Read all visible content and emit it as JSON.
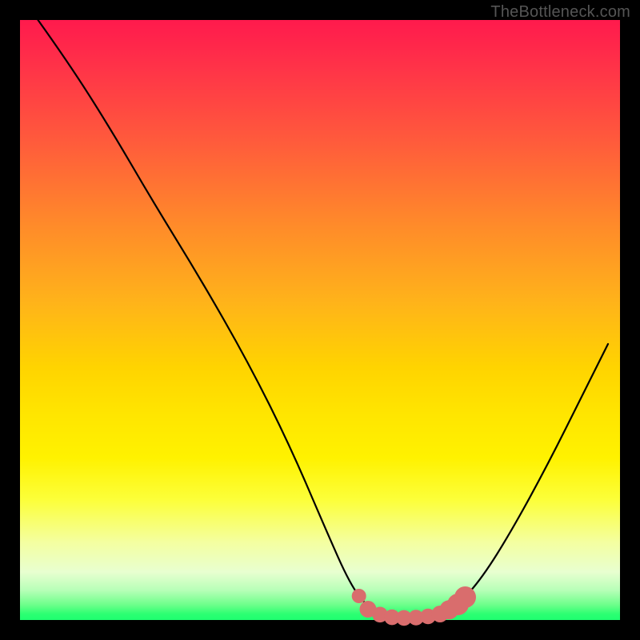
{
  "watermark": "TheBottleneck.com",
  "colors": {
    "page_bg": "#000000",
    "gradient_top": "#ff1a4d",
    "gradient_mid": "#ffe600",
    "gradient_bottom": "#1fff70",
    "curve_stroke": "#000000",
    "marker_fill": "#d96d6d",
    "watermark_text": "#555555"
  },
  "chart_data": {
    "type": "line",
    "title": "",
    "xlabel": "",
    "ylabel": "",
    "xlim": [
      0,
      100
    ],
    "ylim": [
      0,
      100
    ],
    "curve": [
      {
        "x": 3,
        "y": 100
      },
      {
        "x": 8,
        "y": 93
      },
      {
        "x": 15,
        "y": 82
      },
      {
        "x": 22,
        "y": 70
      },
      {
        "x": 30,
        "y": 57
      },
      {
        "x": 38,
        "y": 43
      },
      {
        "x": 45,
        "y": 29
      },
      {
        "x": 51,
        "y": 15
      },
      {
        "x": 55,
        "y": 6
      },
      {
        "x": 58,
        "y": 2
      },
      {
        "x": 62,
        "y": 0.5
      },
      {
        "x": 66,
        "y": 0.4
      },
      {
        "x": 70,
        "y": 1
      },
      {
        "x": 73,
        "y": 2.5
      },
      {
        "x": 77,
        "y": 7
      },
      {
        "x": 82,
        "y": 15
      },
      {
        "x": 88,
        "y": 26
      },
      {
        "x": 94,
        "y": 38
      },
      {
        "x": 98,
        "y": 46
      }
    ],
    "markers": [
      {
        "x": 56.5,
        "y": 4.0,
        "r": 1.2
      },
      {
        "x": 58.0,
        "y": 1.8,
        "r": 1.4
      },
      {
        "x": 60.0,
        "y": 0.9,
        "r": 1.3
      },
      {
        "x": 62.0,
        "y": 0.45,
        "r": 1.3
      },
      {
        "x": 64.0,
        "y": 0.35,
        "r": 1.3
      },
      {
        "x": 66.0,
        "y": 0.4,
        "r": 1.3
      },
      {
        "x": 68.0,
        "y": 0.6,
        "r": 1.3
      },
      {
        "x": 70.0,
        "y": 1.0,
        "r": 1.4
      },
      {
        "x": 71.5,
        "y": 1.7,
        "r": 1.6
      },
      {
        "x": 73.0,
        "y": 2.6,
        "r": 1.8
      },
      {
        "x": 74.2,
        "y": 3.8,
        "r": 1.8
      }
    ]
  }
}
